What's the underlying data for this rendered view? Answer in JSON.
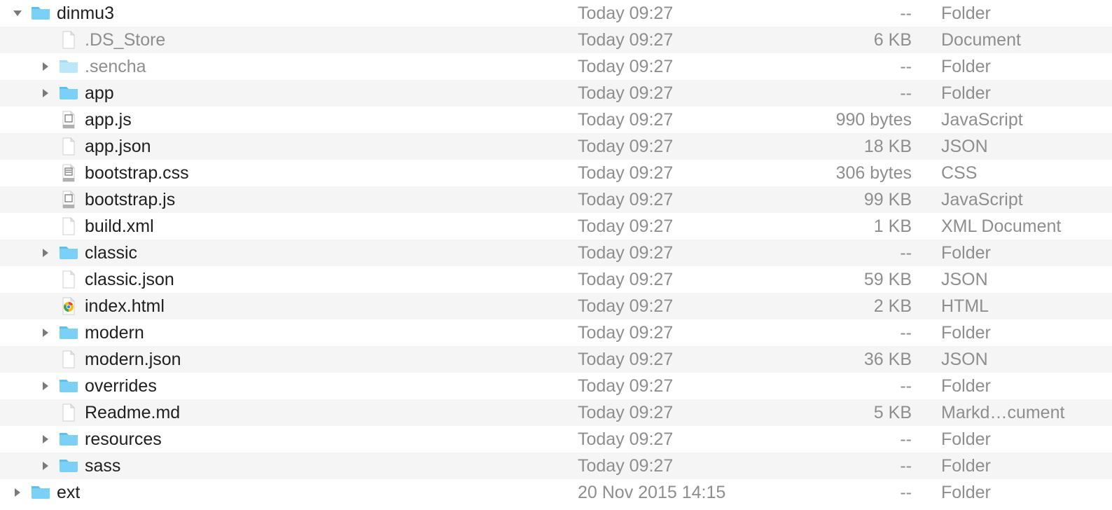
{
  "files": [
    {
      "indent": 0,
      "arrow": "down",
      "icon": "folder",
      "name": "dinmu3",
      "date": "Today 09:27",
      "size": "--",
      "kind": "Folder",
      "dim": false
    },
    {
      "indent": 1,
      "arrow": "none",
      "icon": "doc",
      "name": ".DS_Store",
      "date": "Today 09:27",
      "size": "6 KB",
      "kind": "Document",
      "dim": true
    },
    {
      "indent": 1,
      "arrow": "right",
      "icon": "folder-dim",
      "name": ".sencha",
      "date": "Today 09:27",
      "size": "--",
      "kind": "Folder",
      "dim": true
    },
    {
      "indent": 1,
      "arrow": "right",
      "icon": "folder",
      "name": "app",
      "date": "Today 09:27",
      "size": "--",
      "kind": "Folder",
      "dim": false
    },
    {
      "indent": 1,
      "arrow": "none",
      "icon": "doc-js",
      "name": "app.js",
      "date": "Today 09:27",
      "size": "990 bytes",
      "kind": "JavaScript",
      "dim": false
    },
    {
      "indent": 1,
      "arrow": "none",
      "icon": "doc",
      "name": "app.json",
      "date": "Today 09:27",
      "size": "18 KB",
      "kind": "JSON",
      "dim": false
    },
    {
      "indent": 1,
      "arrow": "none",
      "icon": "doc-css",
      "name": "bootstrap.css",
      "date": "Today 09:27",
      "size": "306 bytes",
      "kind": "CSS",
      "dim": false
    },
    {
      "indent": 1,
      "arrow": "none",
      "icon": "doc-js",
      "name": "bootstrap.js",
      "date": "Today 09:27",
      "size": "99 KB",
      "kind": "JavaScript",
      "dim": false
    },
    {
      "indent": 1,
      "arrow": "none",
      "icon": "doc",
      "name": "build.xml",
      "date": "Today 09:27",
      "size": "1 KB",
      "kind": "XML Document",
      "dim": false
    },
    {
      "indent": 1,
      "arrow": "right",
      "icon": "folder",
      "name": "classic",
      "date": "Today 09:27",
      "size": "--",
      "kind": "Folder",
      "dim": false
    },
    {
      "indent": 1,
      "arrow": "none",
      "icon": "doc",
      "name": "classic.json",
      "date": "Today 09:27",
      "size": "59 KB",
      "kind": "JSON",
      "dim": false
    },
    {
      "indent": 1,
      "arrow": "none",
      "icon": "doc-html",
      "name": "index.html",
      "date": "Today 09:27",
      "size": "2 KB",
      "kind": "HTML",
      "dim": false
    },
    {
      "indent": 1,
      "arrow": "right",
      "icon": "folder",
      "name": "modern",
      "date": "Today 09:27",
      "size": "--",
      "kind": "Folder",
      "dim": false
    },
    {
      "indent": 1,
      "arrow": "none",
      "icon": "doc",
      "name": "modern.json",
      "date": "Today 09:27",
      "size": "36 KB",
      "kind": "JSON",
      "dim": false
    },
    {
      "indent": 1,
      "arrow": "right",
      "icon": "folder",
      "name": "overrides",
      "date": "Today 09:27",
      "size": "--",
      "kind": "Folder",
      "dim": false
    },
    {
      "indent": 1,
      "arrow": "none",
      "icon": "doc",
      "name": "Readme.md",
      "date": "Today 09:27",
      "size": "5 KB",
      "kind": "Markd…cument",
      "dim": false
    },
    {
      "indent": 1,
      "arrow": "right",
      "icon": "folder",
      "name": "resources",
      "date": "Today 09:27",
      "size": "--",
      "kind": "Folder",
      "dim": false
    },
    {
      "indent": 1,
      "arrow": "right",
      "icon": "folder",
      "name": "sass",
      "date": "Today 09:27",
      "size": "--",
      "kind": "Folder",
      "dim": false
    },
    {
      "indent": 0,
      "arrow": "right",
      "icon": "folder",
      "name": "ext",
      "date": "20 Nov 2015 14:15",
      "size": "--",
      "kind": "Folder",
      "dim": false
    }
  ]
}
